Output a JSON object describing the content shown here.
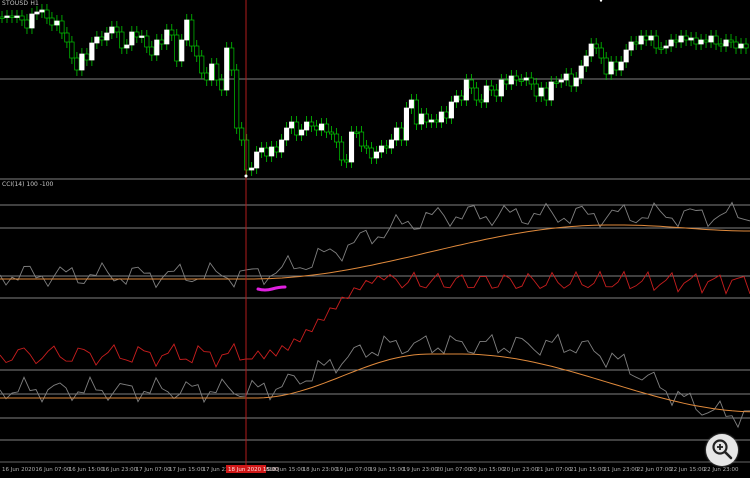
{
  "main_chart": {
    "symbol_label": "STOUSD H1",
    "up_color": "#ffffff",
    "down_color": "#00c800",
    "wick_color": "#00c800",
    "candles": [
      [
        0,
        17
      ],
      [
        1,
        16
      ],
      [
        2,
        17
      ],
      [
        3,
        16
      ],
      [
        4,
        20
      ],
      [
        5,
        28
      ],
      [
        6,
        14
      ],
      [
        7,
        12
      ],
      [
        8,
        10
      ],
      [
        9,
        18
      ],
      [
        10,
        25
      ],
      [
        11,
        21
      ],
      [
        12,
        33
      ],
      [
        13,
        42
      ],
      [
        14,
        58
      ],
      [
        15,
        70
      ],
      [
        16,
        54
      ],
      [
        17,
        60
      ],
      [
        18,
        43
      ],
      [
        19,
        37
      ],
      [
        20,
        40
      ],
      [
        21,
        33
      ],
      [
        22,
        27
      ],
      [
        23,
        32
      ],
      [
        24,
        48
      ],
      [
        25,
        45
      ],
      [
        26,
        32
      ],
      [
        27,
        37
      ],
      [
        28,
        36
      ],
      [
        29,
        47
      ],
      [
        30,
        55
      ],
      [
        31,
        40
      ],
      [
        32,
        44
      ],
      [
        33,
        30
      ],
      [
        34,
        35
      ],
      [
        35,
        61
      ],
      [
        36,
        40
      ],
      [
        37,
        20
      ],
      [
        38,
        46
      ],
      [
        39,
        56
      ],
      [
        40,
        73
      ],
      [
        41,
        80
      ],
      [
        42,
        64
      ],
      [
        43,
        80
      ],
      [
        44,
        90
      ],
      [
        45,
        48
      ],
      [
        46,
        70
      ],
      [
        47,
        128
      ],
      [
        48,
        140
      ],
      [
        49,
        170
      ],
      [
        50,
        168
      ],
      [
        51,
        152
      ],
      [
        52,
        148
      ],
      [
        53,
        156
      ],
      [
        54,
        147
      ],
      [
        55,
        152
      ],
      [
        56,
        140
      ],
      [
        57,
        128
      ],
      [
        58,
        122
      ],
      [
        59,
        135
      ],
      [
        60,
        130
      ],
      [
        61,
        122
      ],
      [
        62,
        126
      ],
      [
        63,
        130
      ],
      [
        64,
        124
      ],
      [
        65,
        132
      ],
      [
        66,
        134
      ],
      [
        67,
        142
      ],
      [
        68,
        160
      ],
      [
        69,
        162
      ],
      [
        70,
        132
      ],
      [
        71,
        132
      ],
      [
        72,
        146
      ],
      [
        73,
        148
      ],
      [
        74,
        158
      ],
      [
        75,
        152
      ],
      [
        76,
        146
      ],
      [
        77,
        148
      ],
      [
        78,
        140
      ],
      [
        79,
        128
      ],
      [
        80,
        140
      ],
      [
        81,
        108
      ],
      [
        82,
        100
      ],
      [
        83,
        124
      ],
      [
        84,
        114
      ],
      [
        85,
        122
      ],
      [
        86,
        120
      ],
      [
        87,
        122
      ],
      [
        88,
        112
      ],
      [
        89,
        118
      ],
      [
        90,
        102
      ],
      [
        91,
        96
      ],
      [
        92,
        100
      ],
      [
        93,
        80
      ],
      [
        94,
        88
      ],
      [
        95,
        100
      ],
      [
        96,
        102
      ],
      [
        97,
        86
      ],
      [
        98,
        90
      ],
      [
        99,
        96
      ],
      [
        100,
        80
      ],
      [
        101,
        84
      ],
      [
        102,
        76
      ],
      [
        103,
        80
      ],
      [
        104,
        80
      ],
      [
        105,
        78
      ],
      [
        106,
        84
      ],
      [
        107,
        96
      ],
      [
        108,
        88
      ],
      [
        109,
        100
      ],
      [
        110,
        82
      ],
      [
        111,
        82
      ],
      [
        112,
        80
      ],
      [
        113,
        74
      ],
      [
        114,
        86
      ],
      [
        115,
        78
      ],
      [
        116,
        66
      ],
      [
        117,
        56
      ],
      [
        118,
        44
      ],
      [
        119,
        48
      ],
      [
        120,
        58
      ],
      [
        121,
        74
      ],
      [
        122,
        62
      ],
      [
        123,
        70
      ],
      [
        124,
        62
      ],
      [
        125,
        50
      ],
      [
        126,
        42
      ],
      [
        127,
        44
      ],
      [
        128,
        36
      ],
      [
        129,
        40
      ],
      [
        130,
        36
      ],
      [
        131,
        48
      ],
      [
        132,
        48
      ],
      [
        133,
        46
      ],
      [
        134,
        40
      ],
      [
        135,
        42
      ],
      [
        136,
        36
      ],
      [
        137,
        40
      ],
      [
        138,
        38
      ],
      [
        139,
        44
      ],
      [
        140,
        40
      ],
      [
        141,
        42
      ],
      [
        142,
        36
      ],
      [
        143,
        44
      ],
      [
        144,
        46
      ],
      [
        145,
        40
      ],
      [
        146,
        42
      ],
      [
        147,
        48
      ],
      [
        148,
        44
      ],
      [
        149,
        48
      ]
    ]
  },
  "indicator": {
    "label": "CCI(14) 100 -100",
    "gray_line_a": [
      0,
      0
    ],
    "orange_ma_a": [
      0,
      0
    ],
    "red_line": [
      0,
      0
    ],
    "gray_line_b": [
      0,
      0
    ],
    "orange_ma_b": [
      0,
      0
    ],
    "magenta_mark": "#e020e0"
  },
  "time_axis": {
    "labels": [
      "16 Jun 2020",
      "16 Jun 07:00",
      "16 Jun 15:00",
      "16 Jun 23:00",
      "17 Jun 07:00",
      "17 Jun 15:00",
      "17 Jun 23:00",
      "18 Jun 07:00",
      "18 Jun 15:00",
      "18 Jun 23:00",
      "19 Jun 07:00",
      "19 Jun 15:00",
      "19 Jun 23:00",
      "20 Jun 07:00",
      "20 Jun 15:00",
      "20 Jun 23:00",
      "21 Jun 07:00",
      "21 Jun 15:00",
      "21 Jun 23:00",
      "22 Jun 07:00",
      "22 Jun 15:00",
      "22 Jun 23:00"
    ],
    "highlight_label": "18 Jun 2020 15:00",
    "highlight_color": "#d01818"
  },
  "crosshair_color": "#b01c1c",
  "grid_color": "#c8c8c8",
  "zoom_button": {
    "icon": "zoom-magnifier-icon"
  }
}
